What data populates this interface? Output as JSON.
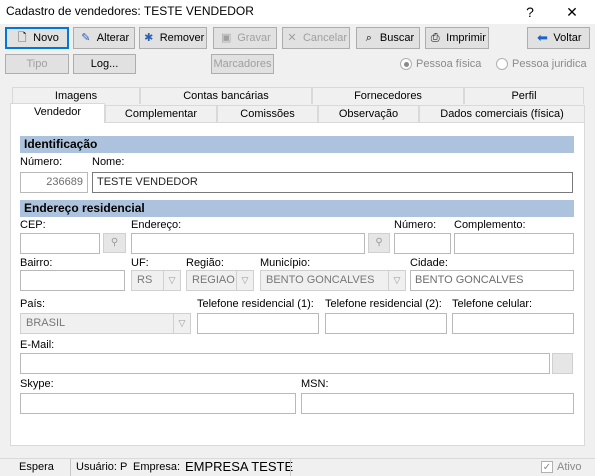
{
  "window": {
    "title": "Cadastro de vendedores: TESTE VENDEDOR",
    "help": "?",
    "close": "✕"
  },
  "toolbar": {
    "novo": "Novo",
    "alterar": "Alterar",
    "remover": "Remover",
    "gravar": "Gravar",
    "cancelar": "Cancelar",
    "buscar": "Buscar",
    "imprimir": "Imprimir",
    "voltar": "Voltar"
  },
  "toolbar2": {
    "tipo": "Tipo",
    "log": "Log...",
    "marcadores": "Marcadores",
    "pessoa_fisica": "Pessoa física",
    "pessoa_juridica": "Pessoa juridica"
  },
  "tabs_row1": [
    "Imagens",
    "Contas bancárias",
    "Fornecedores",
    "Perfil"
  ],
  "tabs_row2": [
    "Vendedor",
    "Complementar",
    "Comissões",
    "Observação",
    "Dados comerciais (física)"
  ],
  "identificacao": {
    "header": "Identificação",
    "numero_label": "Número:",
    "numero": "236689",
    "nome_label": "Nome:",
    "nome": "TESTE VENDEDOR"
  },
  "endereco": {
    "header": "Endereço residencial",
    "cep_label": "CEP:",
    "endereco_label": "Endereço:",
    "numero_label": "Número:",
    "complemento_label": "Complemento:",
    "bairro_label": "Bairro:",
    "uf_label": "UF:",
    "uf": "RS",
    "regiao_label": "Região:",
    "regiao": "REGIAO",
    "municipio_label": "Município:",
    "municipio": "BENTO GONCALVES",
    "cidade_label": "Cidade:",
    "cidade": "BENTO GONCALVES",
    "pais_label": "País:",
    "pais": "BRASIL",
    "tel1_label": "Telefone residencial (1):",
    "tel2_label": "Telefone residencial (2):",
    "cel_label": "Telefone celular:",
    "email_label": "E-Mail:",
    "skype_label": "Skype:",
    "msn_label": "MSN:"
  },
  "status": {
    "espera": "Espera",
    "usuario": "Usuário: P",
    "empresa_label": "Empresa:",
    "empresa": "EMPRESA TESTE",
    "ativo": "Ativo"
  }
}
